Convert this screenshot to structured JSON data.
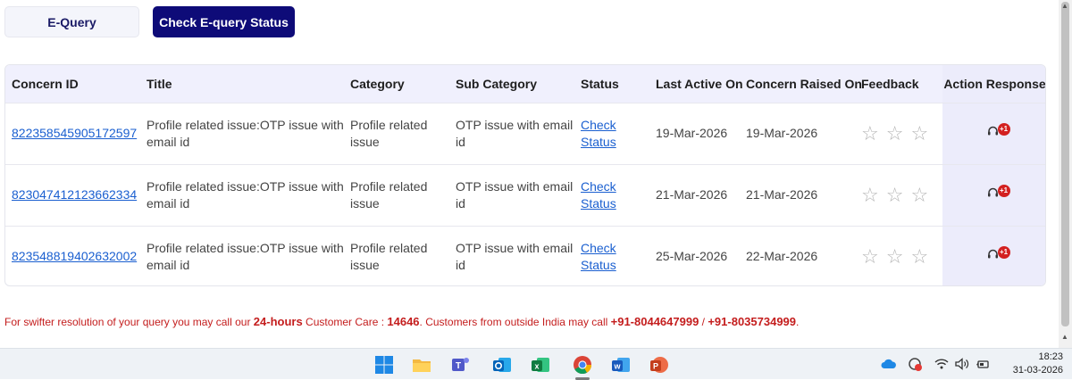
{
  "tabs": {
    "equery": "E-Query",
    "check_status": "Check E-query Status"
  },
  "table": {
    "headers": [
      "Concern ID",
      "Title",
      "Category",
      "Sub Category",
      "Status",
      "Last Active On",
      "Concern Raised On",
      "Feedback",
      "Action Response"
    ],
    "rows": [
      {
        "concern_id": "822358545905172597",
        "title": "Profile related issue:OTP issue with email id",
        "category": "Profile related issue",
        "sub_category": "OTP issue with email id",
        "status": "Check Status",
        "last_active": "19-Mar-2026",
        "raised_on": "19-Mar-2026",
        "badge": "+1"
      },
      {
        "concern_id": "823047412123662334",
        "title": "Profile related issue:OTP issue with email id",
        "category": "Profile related issue",
        "sub_category": "OTP issue with email id",
        "status": "Check Status",
        "last_active": "21-Mar-2026",
        "raised_on": "21-Mar-2026",
        "badge": "+1"
      },
      {
        "concern_id": "823548819402632002",
        "title": "Profile related issue:OTP issue with email id",
        "category": "Profile related issue",
        "sub_category": "OTP issue with email id",
        "status": "Check Status",
        "last_active": "25-Mar-2026",
        "raised_on": "22-Mar-2026",
        "badge": "+1"
      }
    ]
  },
  "notice": {
    "part1": "For swifter resolution of your query you may call our ",
    "hours": "24-hours",
    "part2": " Customer Care : ",
    "number": "14646",
    "part3": ". Customers from outside India may call ",
    "intl1": "+91-8044647999",
    "sep": " / ",
    "intl2": "+91-8035734999",
    "part4": "."
  },
  "taskbar": {
    "apps": [
      "windows-start",
      "file-explorer",
      "teams",
      "outlook",
      "excel",
      "chrome",
      "word",
      "powerpoint"
    ],
    "time": "18:23",
    "date": "31-03-2026"
  },
  "colors": {
    "accent": "#0e0b78",
    "link": "#1a5fd0",
    "notice": "#c41d1d",
    "header_bg": "#f0f0fd"
  }
}
